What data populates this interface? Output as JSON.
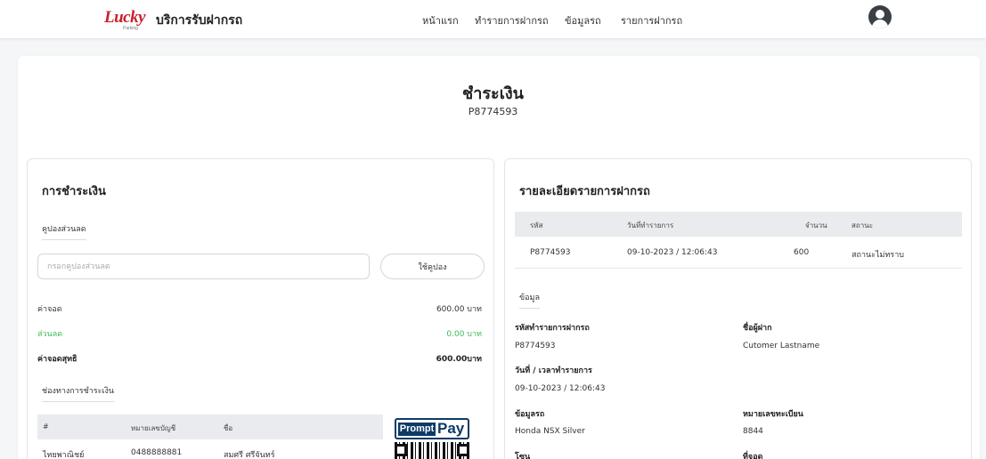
{
  "header": {
    "logo_text": "Lucky",
    "logo_sub": "Parking",
    "brand": "บริการรับฝากรถ",
    "nav": [
      "หน้าแรก",
      "ทำรายการฝากรถ",
      "ข้อมูลรถ",
      "รายการฝากรถ"
    ],
    "avatar_icon": "user-avatar-icon"
  },
  "page": {
    "title": "ชำระเงิน",
    "ref": "P8774593"
  },
  "payment": {
    "title": "การชำระเงิน",
    "coupon_label": "คูปองส่วนลด",
    "coupon_placeholder": "กรอกคูปองส่วนลด",
    "coupon_button": "ใช้คูปอง",
    "fee_label": "ค่าจอด",
    "fee_value": "600.00 บาท",
    "discount_label": "ส่วนลด",
    "discount_value": "0.00 บาท",
    "net_label": "ค่าจอดสุทธิ",
    "net_value": "600.00บาท",
    "channels_label": "ช่องทางการชำระเงิน",
    "channels_headers": [
      "#",
      "หมายเลขบัญชี",
      "ชื่อ"
    ],
    "channels_rows": [
      {
        "bank": "ไทยพาณิชย์",
        "account": "0488888881",
        "name": "สมศรี ศรีจันทร์"
      }
    ],
    "promptpay_prompt": "Prompt",
    "promptpay_pay": "Pay"
  },
  "details": {
    "title": "รายละเอียดรายการฝากรถ",
    "headers": [
      "รหัส",
      "วันที่ทำรายการ",
      "จำนวน",
      "สถานะ"
    ],
    "row": {
      "code": "P8774593",
      "datetime": "09-10-2023 / 12:06:43",
      "amount": "600",
      "status": "สถานะไม่ทราบ"
    },
    "info_label": "ข้อมูล",
    "fields": {
      "txn_label": "รหัสทำรายการฝากรถ",
      "txn_value": "P8774593",
      "depositor_label": "ชื่อผู้ฝาก",
      "depositor_value": "Cutomer Lastname",
      "datetime_label": "วันที่ / เวลาทำรายการ",
      "datetime_value": "09-10-2023 / 12:06:43",
      "car_label": "ข้อมูลรถ",
      "car_value": "Honda NSX Silver",
      "plate_label": "หมายเลขทะเบียน",
      "plate_value": "8844",
      "zone_label": "โซน",
      "slot_label": "ที่จอด"
    }
  }
}
